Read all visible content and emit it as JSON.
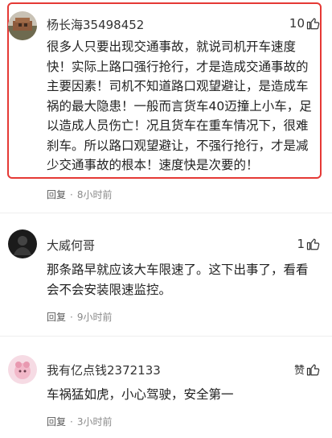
{
  "comments": [
    {
      "username": "杨长海35498452",
      "likes": "10",
      "text": "很多人只要出现交通事故，就说司机开车速度快！实际上路口强行抢行，才是造成交通事故的主要因素！司机不知道路口观望避让，是造成车祸的最大隐患！一般而言货车40迈撞上小车，足以造成人员伤亡！况且货车在重车情况下，很难刹车。所以路口观望避让，不强行抢行，才是减少交通事故的根本！速度快是次要的！",
      "reply_label": "回复",
      "separator": "·",
      "time": "8小时前",
      "highlighted": true
    },
    {
      "username": "大威何哥",
      "likes": "1",
      "text": "那条路早就应该大车限速了。这下出事了，看看会不会安装限速监控。",
      "reply_label": "回复",
      "separator": "·",
      "time": "9小时前",
      "highlighted": false
    },
    {
      "username": "我有亿点钱2372133",
      "likes": "赞",
      "text": "车祸猛如虎，小心驾驶，安全第一",
      "reply_label": "回复",
      "separator": "·",
      "time": "3小时前",
      "highlighted": false
    }
  ],
  "colors": {
    "highlight_border": "#e53935",
    "meta_text": "#8a8a8a",
    "body_text": "#222222"
  }
}
